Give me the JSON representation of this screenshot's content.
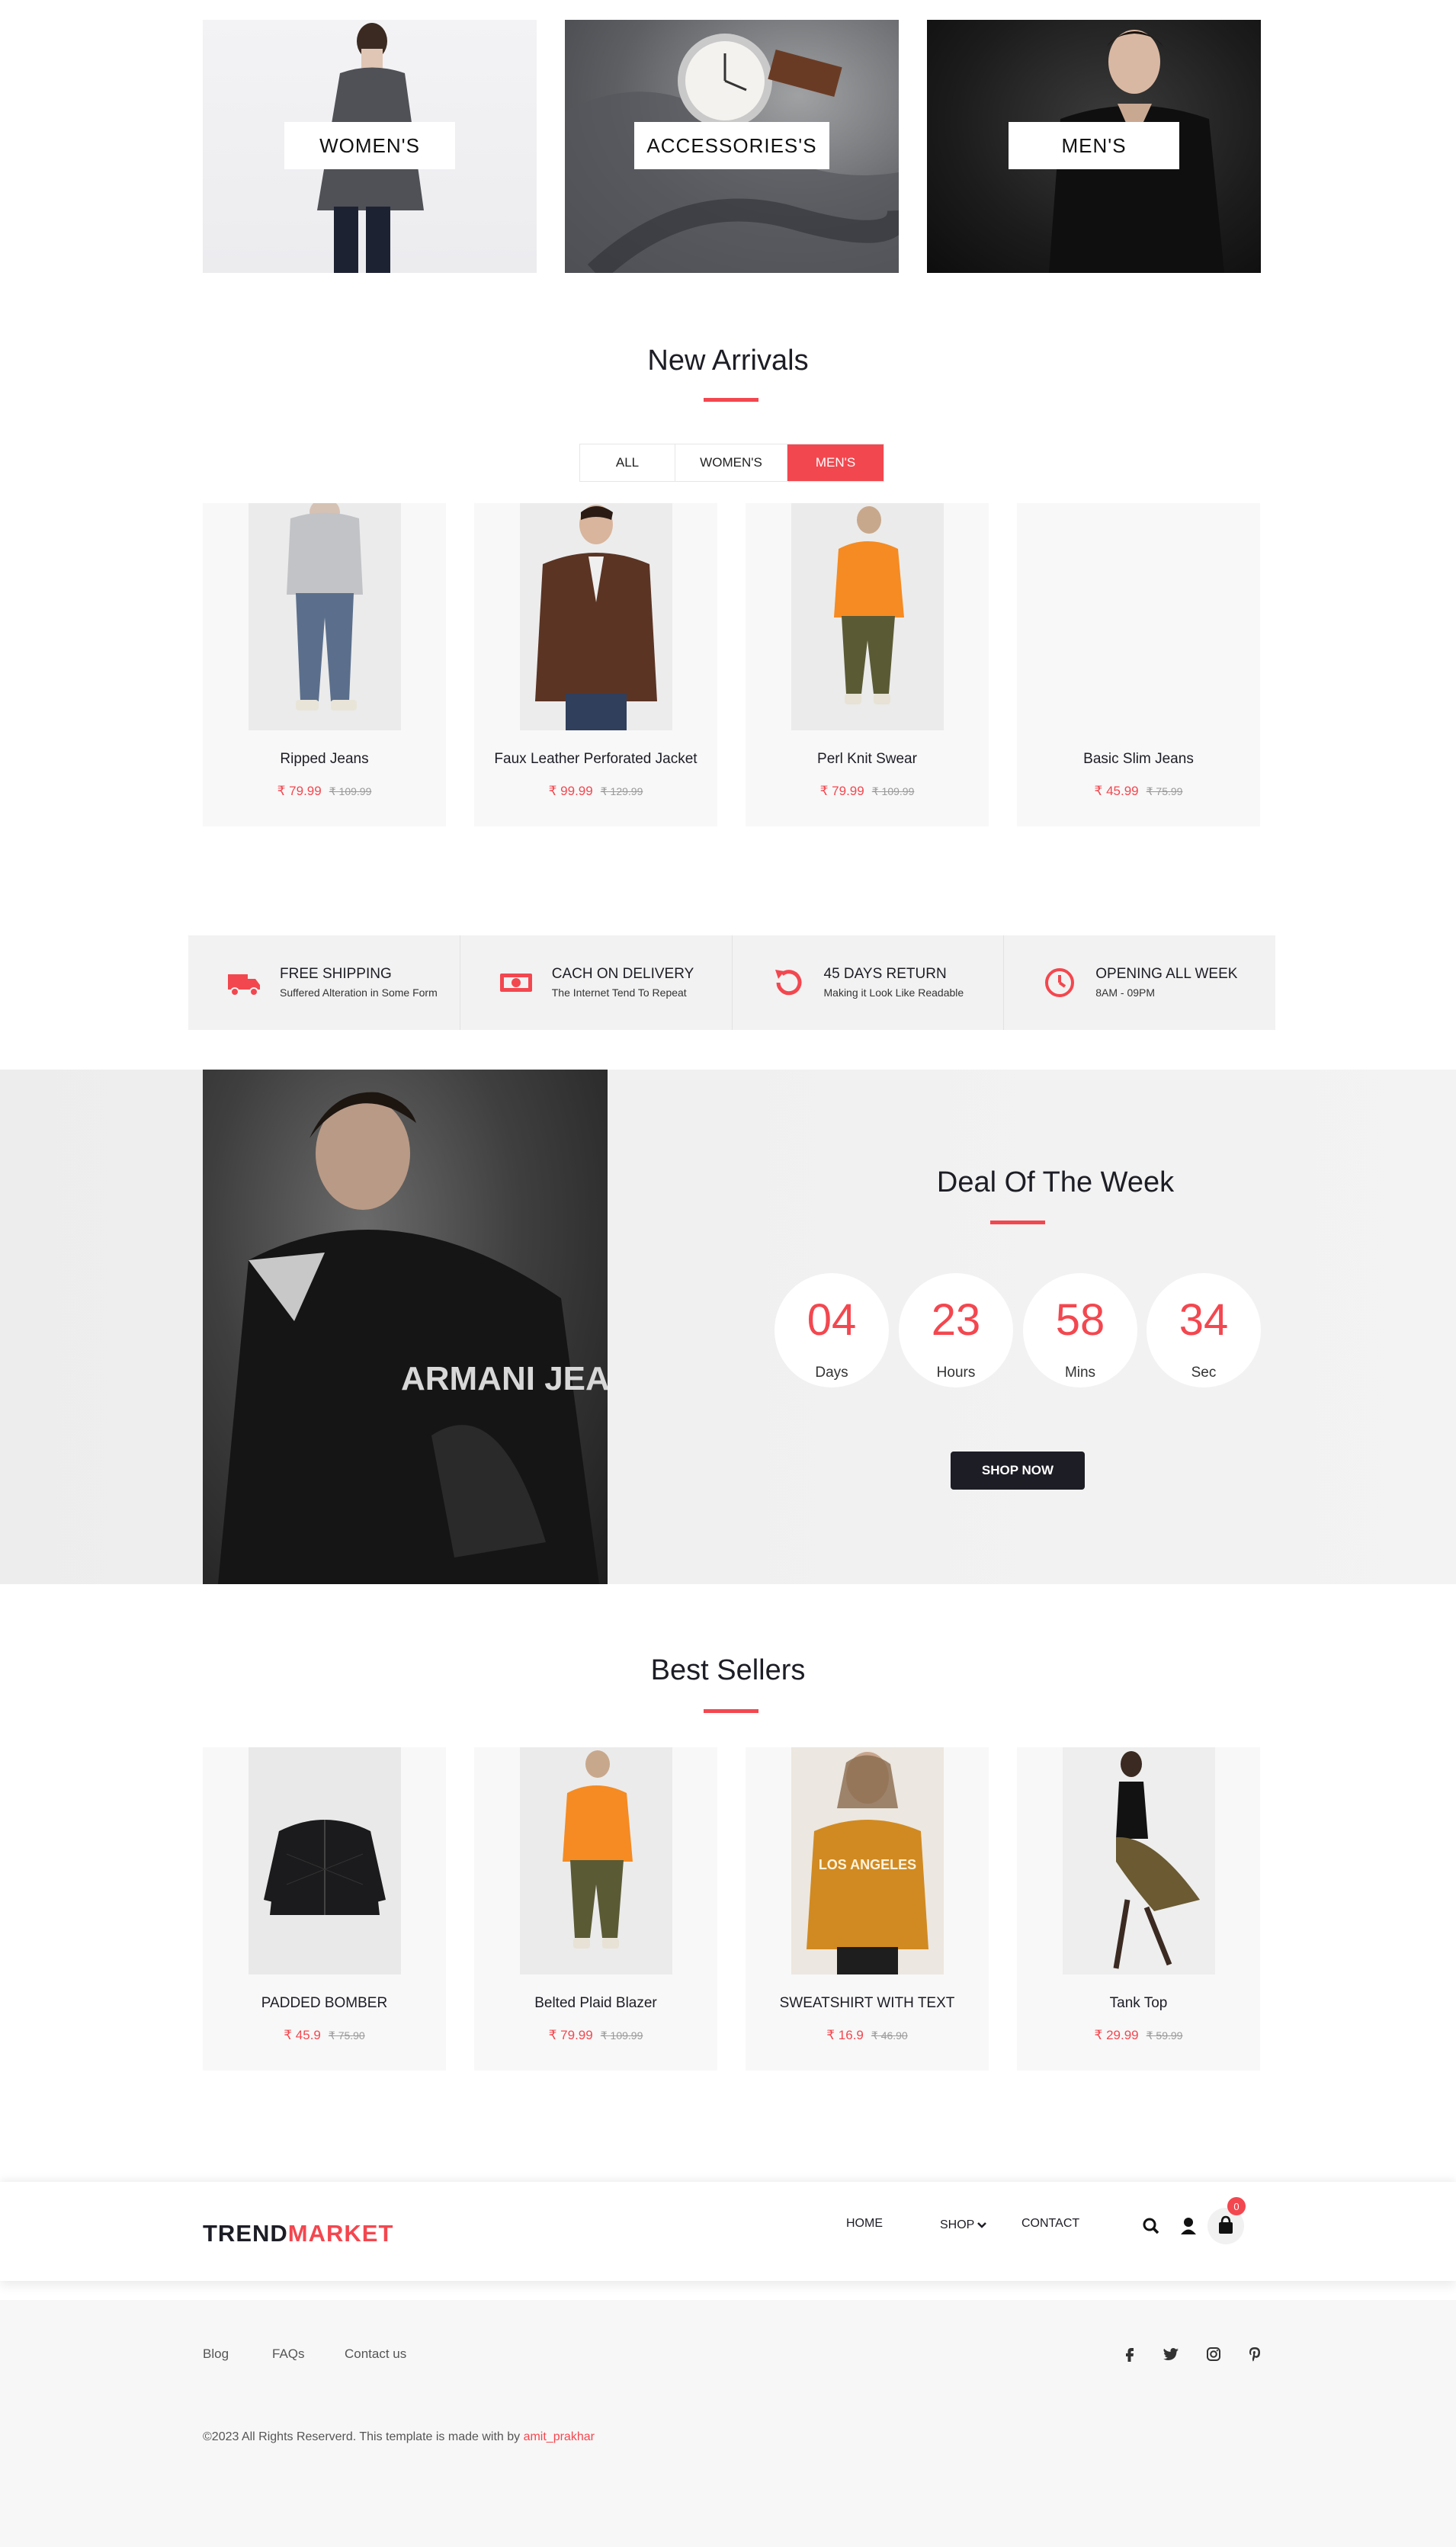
{
  "categories": [
    {
      "label": "WOMEN'S"
    },
    {
      "label": "ACCESSORIES'S"
    },
    {
      "label": "MEN'S"
    }
  ],
  "new_arrivals": {
    "title": "New Arrivals",
    "filters": [
      "ALL",
      "WOMEN'S",
      "MEN'S"
    ],
    "active_filter": "MEN'S",
    "products": [
      {
        "name": "Ripped Jeans",
        "price": "₹ 79.99",
        "old_price": "₹ 109.99"
      },
      {
        "name": "Faux Leather Perforated Jacket",
        "price": "₹ 99.99",
        "old_price": "₹ 129.99"
      },
      {
        "name": "Perl Knit Swear",
        "price": "₹ 79.99",
        "old_price": "₹ 109.99"
      },
      {
        "name": "Basic Slim Jeans",
        "price": "₹ 45.99",
        "old_price": "₹ 75.99"
      }
    ]
  },
  "features": [
    {
      "title": "FREE SHIPPING",
      "subtitle": "Suffered Alteration in Some Form",
      "icon": "truck-icon"
    },
    {
      "title": "CACH ON DELIVERY",
      "subtitle": "The Internet Tend To Repeat",
      "icon": "money-icon"
    },
    {
      "title": "45 DAYS RETURN",
      "subtitle": "Making it Look Like Readable",
      "icon": "return-icon"
    },
    {
      "title": "OPENING ALL WEEK",
      "subtitle": "8AM - 09PM",
      "icon": "clock-icon"
    }
  ],
  "deal": {
    "title": "Deal Of The Week",
    "timer": [
      {
        "value": "04",
        "label": "Days"
      },
      {
        "value": "23",
        "label": "Hours"
      },
      {
        "value": "58",
        "label": "Mins"
      },
      {
        "value": "34",
        "label": "Sec"
      }
    ],
    "button": "SHOP NOW"
  },
  "best_sellers": {
    "title": "Best Sellers",
    "products": [
      {
        "name": "PADDED BOMBER",
        "price": "₹ 45.9",
        "old_price": "₹ 75.90"
      },
      {
        "name": "Belted Plaid Blazer",
        "price": "₹ 79.99",
        "old_price": "₹ 109.99"
      },
      {
        "name": "SWEATSHIRT WITH TEXT",
        "price": "₹ 16.9",
        "old_price": "₹ 46.90"
      },
      {
        "name": "Tank Top",
        "price": "₹ 29.99",
        "old_price": "₹ 59.99"
      }
    ]
  },
  "header": {
    "logo_part1": "TREND",
    "logo_part2": "MARKET",
    "nav": [
      "HOME",
      "SHOP",
      "CONTACT"
    ],
    "cart_count": "0",
    "icons": [
      "search-icon",
      "user-icon",
      "bag-icon"
    ]
  },
  "footer": {
    "links": [
      "Blog",
      "FAQs",
      "Contact us"
    ],
    "social": [
      "facebook-icon",
      "twitter-icon",
      "instagram-icon",
      "pinterest-icon"
    ],
    "copyright": "©2023 All Rights Reserverd. This template is made with  by ",
    "author": "amit_prakhar"
  },
  "colors": {
    "accent": "#f3474f",
    "dark": "#1d1d26"
  }
}
